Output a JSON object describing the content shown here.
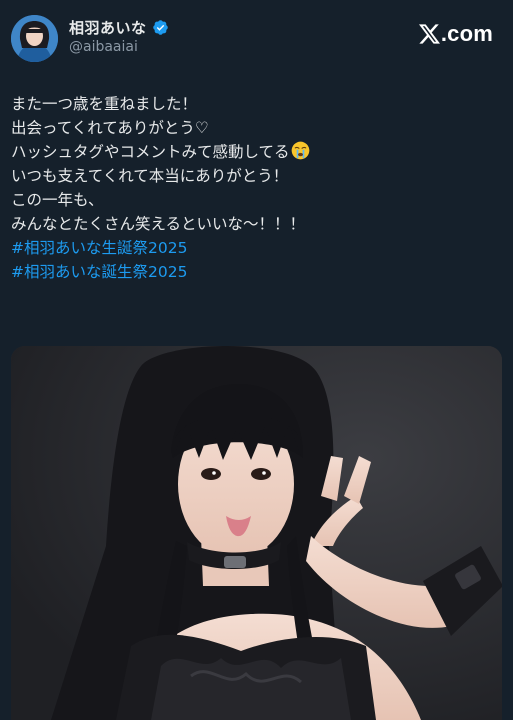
{
  "author": {
    "display_name": "相羽あいな",
    "handle": "@aibaaiai",
    "verified": true,
    "avatar_alt": "profile photo"
  },
  "site": {
    "logo_icon": "x-logo-icon",
    "domain_suffix": ".com"
  },
  "tweet": {
    "lines": [
      "また一つ歳を重ねました！",
      "出会ってくれてありがとう♡",
      "ハッシュタグやコメントみて感動してる",
      "いつも支えてくれて本当にありがとう！",
      "この一年も、",
      "みんなとたくさん笑えるといいな〜！！！"
    ],
    "emoji": "crying-face-emoji",
    "hashtags": [
      "#相羽あいな生誕祭2025",
      "#相羽あいな誕生祭2025"
    ]
  },
  "media": {
    "type": "photo",
    "description_icon": "photo-image"
  },
  "colors": {
    "background": "#15202b",
    "text": "#e7e9ea",
    "secondary_text": "#8b98a5",
    "link": "#1d9bf0",
    "verified_badge": "#1d9bf0"
  }
}
